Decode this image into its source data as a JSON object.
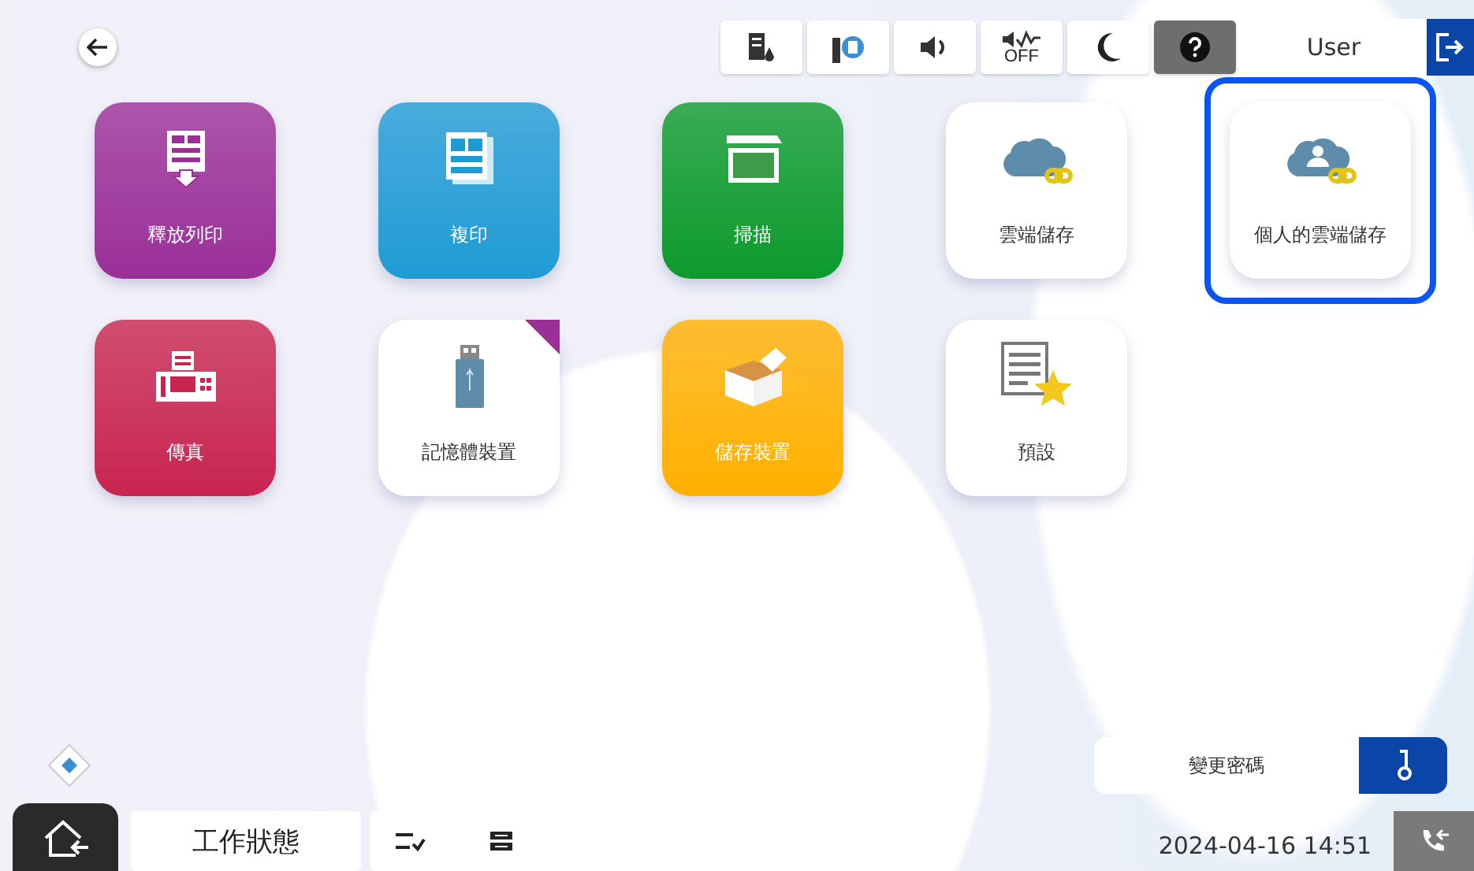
{
  "top_bar": {
    "status_icons": [
      {
        "kind": "ink",
        "active": false
      },
      {
        "kind": "maintenance",
        "active": false
      },
      {
        "kind": "volume",
        "active": false
      },
      {
        "kind": "quiet-off",
        "label": "OFF",
        "active": false
      },
      {
        "kind": "sleep",
        "active": false
      },
      {
        "kind": "help",
        "active": true
      }
    ],
    "user": "User"
  },
  "tiles": [
    {
      "label": "釋放列印",
      "kind": "release-print",
      "color": "#9a2f98",
      "selected": false
    },
    {
      "label": "複印",
      "kind": "copy",
      "color": "#1f9bd4",
      "selected": false
    },
    {
      "label": "掃描",
      "kind": "scan",
      "color": "#0c9a2c",
      "selected": false
    },
    {
      "label": "雲端儲存",
      "kind": "cloud",
      "color": "#ffffff",
      "selected": false
    },
    {
      "label": "個人的雲端儲存",
      "kind": "personal-cloud",
      "color": "#ffffff",
      "selected": true
    },
    {
      "label": "傳真",
      "kind": "fax",
      "color": "#c8254f",
      "selected": false
    },
    {
      "label": "記憶體裝置",
      "kind": "memory",
      "color": "#ffffff",
      "selected": false
    },
    {
      "label": "儲存裝置",
      "kind": "storage",
      "color": "#ffb000",
      "selected": false
    },
    {
      "label": "預設",
      "kind": "preset",
      "color": "#ffffff",
      "selected": false
    }
  ],
  "change_password": "變更密碼",
  "bottom_bar": {
    "job_status": "工作狀態",
    "datetime": "2024-04-16 14:51"
  }
}
